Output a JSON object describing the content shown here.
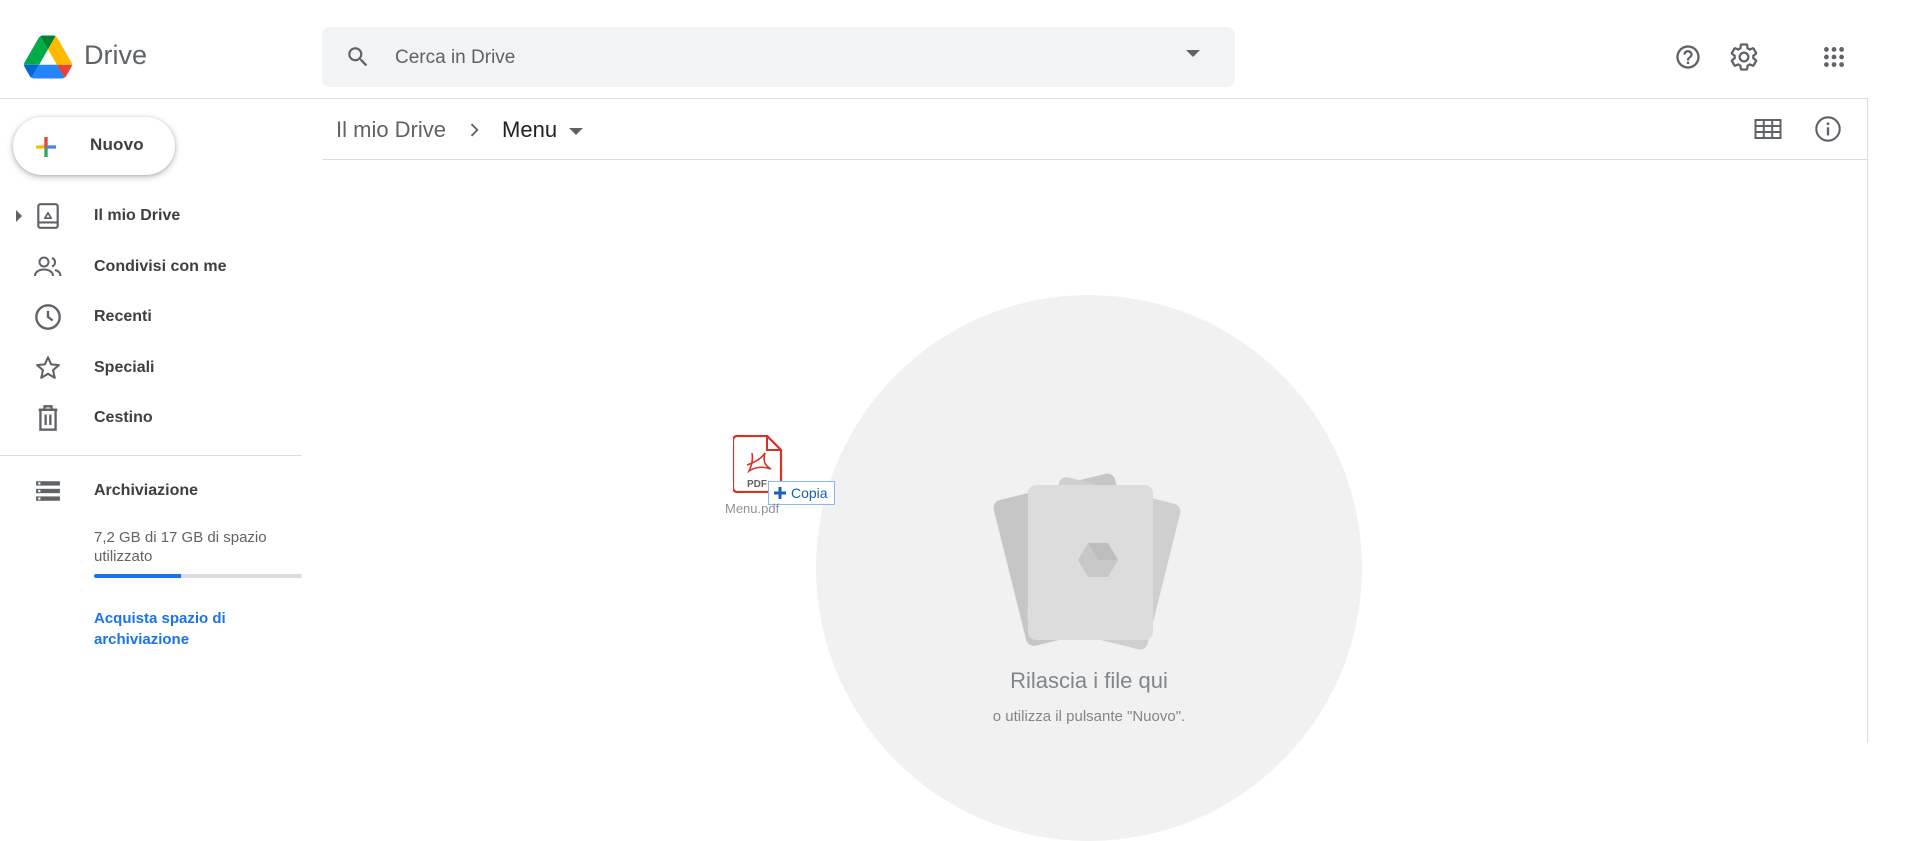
{
  "header": {
    "app_name": "Drive",
    "search_placeholder": "Cerca in Drive",
    "icons": [
      "drive-logo-icon",
      "search-icon",
      "search-options-icon",
      "help-icon",
      "settings-icon",
      "apps-grid-icon"
    ]
  },
  "sidebar": {
    "new_label": "Nuovo",
    "items": [
      {
        "label": "Il mio Drive",
        "icon": "my-drive-icon"
      },
      {
        "label": "Condivisi con me",
        "icon": "people-icon"
      },
      {
        "label": "Recenti",
        "icon": "clock-icon"
      },
      {
        "label": "Speciali",
        "icon": "star-icon"
      },
      {
        "label": "Cestino",
        "icon": "trash-icon"
      }
    ],
    "storage": {
      "label": "Archiviazione",
      "usage_text": "7,2 GB di 17 GB di spazio utilizzato",
      "used_fraction": 0.42,
      "buy_link": "Acquista spazio di archiviazione"
    }
  },
  "breadcrumb": {
    "root": "Il mio Drive",
    "current": "Menu"
  },
  "drop_zone": {
    "title": "Rilascia i file qui",
    "subtitle": "o utilizza il pulsante \"Nuovo\"."
  },
  "drag": {
    "file_name": "Menu.pdf",
    "file_type": "PDF",
    "action_label": "Copia"
  },
  "colors": {
    "accent": "#1a73e8",
    "pdf_red": "#d93025"
  }
}
